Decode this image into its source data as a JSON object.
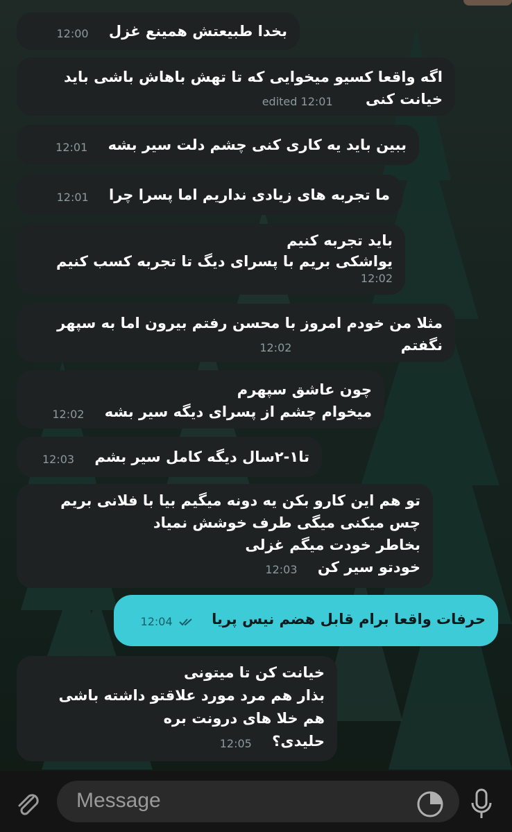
{
  "messages": [
    {
      "text": "بخدا طبیعتش همینع غزل",
      "time": "12:00"
    },
    {
      "lines": [
        "اگه واقعا کسیو میخوایی که تا تهش باهاش باشی باید",
        "خیانت کنی"
      ],
      "time": "edited 12:01"
    },
    {
      "text": "ببین باید یه کاری کنی چشم دلت سیر بشه",
      "time": "12:01"
    },
    {
      "text": "ما تجربه های زیادی نداریم اما پسرا چرا",
      "time": "12:01"
    },
    {
      "lines": [
        "باید تجربه کنیم",
        "یواشکی بریم با پسرای دیگ تا تجربه کسب کنیم"
      ],
      "time": "12:02"
    },
    {
      "lines": [
        "مثلا من خودم امروز با محسن رفتم بیرون اما به سپهر",
        "نگفتم"
      ],
      "time": "12:02"
    },
    {
      "lines": [
        "چون عاشق سپهرم",
        "میخوام چشم از پسرای دیگه سیر بشه"
      ],
      "time": "12:02"
    },
    {
      "text": "تا۱-۲سال دیگه کامل سیر بشم",
      "time": "12:03"
    },
    {
      "lines": [
        "تو هم این کارو بکن یه دونه میگیم بیا با فلانی بریم",
        "چس میکنی میگی طرف خوشش نمیاد",
        "بخاطر خودت میگم غزلی",
        "خودتو سیر کن"
      ],
      "time": "12:03"
    },
    {
      "text": "حرفات واقعا برام قابل هضم نیس پریا",
      "time": "12:04",
      "outgoing": true
    },
    {
      "lines": [
        "خیانت کن تا میتونی",
        "بذار هم مرد مورد علاقتو داشته باشی",
        "هم خلا های درونت بره",
        "حلیدی؟"
      ],
      "time": "12:05"
    }
  ],
  "composer": {
    "placeholder": "Message"
  },
  "icons": {
    "attach": "paperclip-icon",
    "sticker": "sticker-icon",
    "mic": "microphone-icon",
    "read": "double-check-icon"
  },
  "colors": {
    "incoming_bubble": "#1e2222",
    "outgoing_bubble": "#3ecbd8",
    "background": "#16221d"
  }
}
